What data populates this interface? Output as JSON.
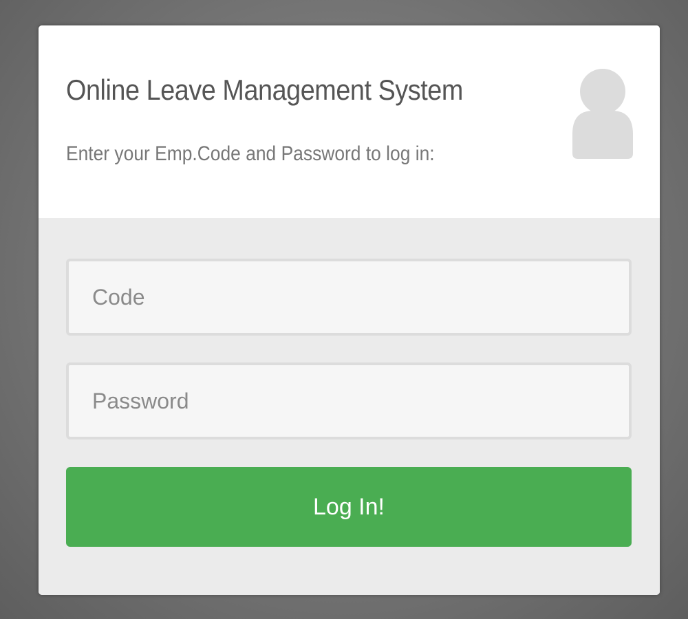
{
  "header": {
    "title": "Online Leave Management System",
    "subtitle": "Enter your Emp.Code and Password to log in:",
    "icon": "user-avatar-icon"
  },
  "form": {
    "code": {
      "placeholder": "Code",
      "value": ""
    },
    "password": {
      "placeholder": "Password",
      "value": ""
    },
    "submit_label": "Log In!"
  },
  "colors": {
    "accent_green": "#4aad52",
    "icon_gray": "#dcdcdc"
  }
}
